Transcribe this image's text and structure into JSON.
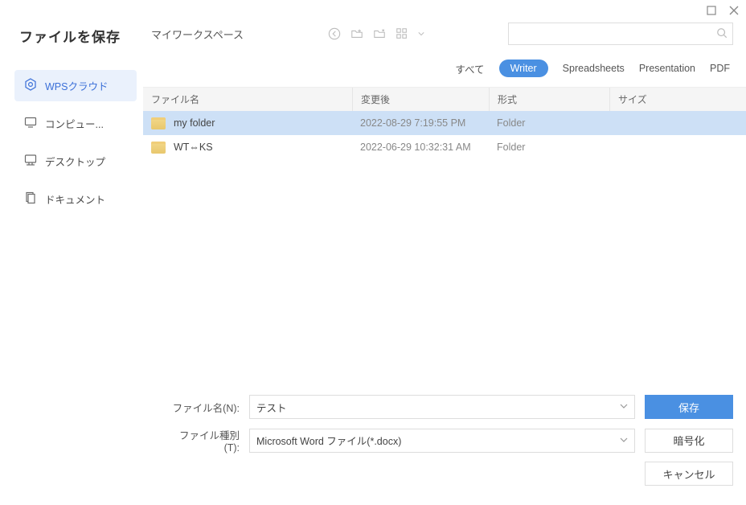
{
  "dialog": {
    "title": "ファイルを保存"
  },
  "sidebar": {
    "items": [
      {
        "label": "WPSクラウド"
      },
      {
        "label": "コンピュー..."
      },
      {
        "label": "デスクトップ"
      },
      {
        "label": "ドキュメント"
      }
    ]
  },
  "breadcrumb": "マイワークスペース",
  "search": {
    "placeholder": ""
  },
  "tabs": {
    "items": [
      {
        "label": "すべて"
      },
      {
        "label": "Writer"
      },
      {
        "label": "Spreadsheets"
      },
      {
        "label": "Presentation"
      },
      {
        "label": "PDF"
      }
    ]
  },
  "columns": {
    "name": "ファイル名",
    "modified": "変更後",
    "format": "形式",
    "size": "サイズ"
  },
  "files": [
    {
      "name": "my folder",
      "modified": "2022-08-29 7:19:55 PM",
      "format": "Folder",
      "size": ""
    },
    {
      "name": "WT⇔KS",
      "modified": "2022-06-29 10:32:31 AM",
      "format": "Folder",
      "size": ""
    }
  ],
  "form": {
    "filenameLabel": "ファイル名(N):",
    "filenameValue": "テスト",
    "filetypeLabel": "ファイル種別(T):",
    "filetypeValue": "Microsoft Word ファイル(*.docx)"
  },
  "buttons": {
    "save": "保存",
    "encrypt": "暗号化",
    "cancel": "キャンセル"
  }
}
